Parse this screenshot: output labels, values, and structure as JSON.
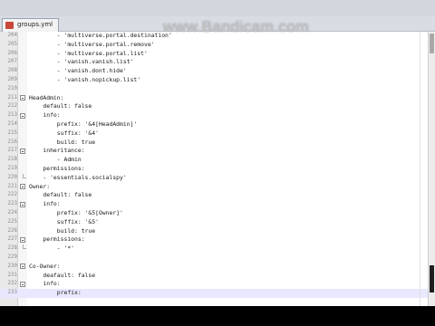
{
  "watermark": "www.Bandicam.com",
  "tab": {
    "label": "groups.yml",
    "icon": "yml-file-icon"
  },
  "lines": [
    {
      "n": "204",
      "text": "        - 'multiverse.portal.destination'"
    },
    {
      "n": "205",
      "text": "        - 'multiverse.portal.remove'"
    },
    {
      "n": "206",
      "text": "        - 'multiverse.portal.list'"
    },
    {
      "n": "207",
      "text": "        - 'vanish.vanish.list'"
    },
    {
      "n": "208",
      "text": "        - 'vanish.dont.hide'"
    },
    {
      "n": "209",
      "text": "        - 'vanish.nopickup.list'"
    },
    {
      "n": "210",
      "text": ""
    },
    {
      "n": "211",
      "text": "HeadAdmin:",
      "fold": "open"
    },
    {
      "n": "212",
      "text": "    default: false"
    },
    {
      "n": "213",
      "text": "    info:",
      "fold": "open"
    },
    {
      "n": "214",
      "text": "        prefix: '&4[HeadAdmin]'"
    },
    {
      "n": "215",
      "text": "        suffix: '&4'"
    },
    {
      "n": "216",
      "text": "        build: true"
    },
    {
      "n": "217",
      "text": "    inheritance:",
      "fold": "open"
    },
    {
      "n": "218",
      "text": "        - Admin"
    },
    {
      "n": "219",
      "text": "    permissions:"
    },
    {
      "n": "220",
      "text": "    - 'essentials.socialspy'",
      "fold": "end"
    },
    {
      "n": "221",
      "text": "Owner:",
      "fold": "open"
    },
    {
      "n": "222",
      "text": "    default: false"
    },
    {
      "n": "223",
      "text": "    info:",
      "fold": "open"
    },
    {
      "n": "224",
      "text": "        prefix: '&5[Owner]'"
    },
    {
      "n": "225",
      "text": "        suffix: '&5'"
    },
    {
      "n": "226",
      "text": "        build: true"
    },
    {
      "n": "227",
      "text": "    permissions:",
      "fold": "open"
    },
    {
      "n": "228",
      "text": "        - '*'",
      "fold": "end"
    },
    {
      "n": "229",
      "text": ""
    },
    {
      "n": "230",
      "text": "Co-Owner:",
      "fold": "open"
    },
    {
      "n": "231",
      "text": "    deafault: false"
    },
    {
      "n": "232",
      "text": "    info:",
      "fold": "open"
    },
    {
      "n": "233",
      "text": "        prefix:",
      "current": true
    }
  ]
}
